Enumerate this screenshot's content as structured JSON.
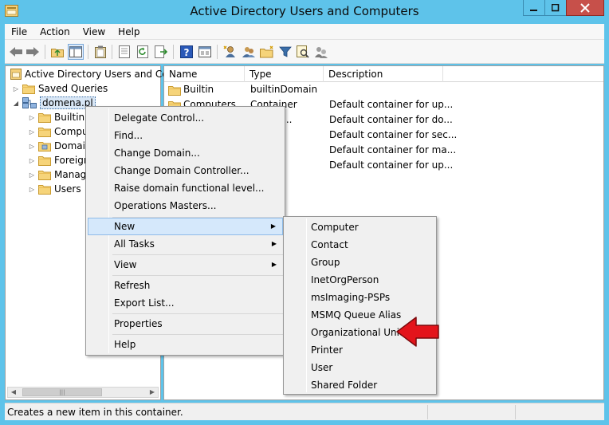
{
  "window": {
    "title": "Active Directory Users and Computers"
  },
  "menubar": [
    "File",
    "Action",
    "View",
    "Help"
  ],
  "tree": {
    "root": "Active Directory Users and Com",
    "saved_queries": "Saved Queries",
    "domain": "domena.pl",
    "children": [
      "Builtin",
      "Compu",
      "Domain",
      "Foreign",
      "Manag",
      "Users"
    ]
  },
  "list": {
    "columns": [
      "Name",
      "Type",
      "Description"
    ],
    "rows": [
      {
        "name": "Builtin",
        "type": "builtinDomain",
        "description": ""
      },
      {
        "name": "Computers",
        "type": "Container",
        "description": "Default container for up..."
      },
      {
        "name": "",
        "type": "ational...",
        "description": "Default container for do..."
      },
      {
        "name": "",
        "type": "r",
        "description": "Default container for sec..."
      },
      {
        "name": "",
        "type": "r",
        "description": "Default container for ma..."
      },
      {
        "name": "",
        "type": "r",
        "description": "Default container for up..."
      }
    ]
  },
  "context_menu": {
    "items": [
      "Delegate Control...",
      "Find...",
      "Change Domain...",
      "Change Domain Controller...",
      "Raise domain functional level...",
      "Operations Masters...",
      "New",
      "All Tasks",
      "View",
      "Refresh",
      "Export List...",
      "Properties",
      "Help"
    ],
    "highlighted": "New"
  },
  "submenu": {
    "items": [
      "Computer",
      "Contact",
      "Group",
      "InetOrgPerson",
      "msImaging-PSPs",
      "MSMQ Queue Alias",
      "Organizational Unit",
      "Printer",
      "User",
      "Shared Folder"
    ]
  },
  "statusbar": {
    "text": "Creates a new item in this container."
  },
  "icons": {
    "nav": [
      "back-arrow-icon",
      "forward-arrow-icon"
    ],
    "tools": [
      "up-folder-icon",
      "console-tree-icon",
      "clipboard-icon",
      "properties-icon",
      "refresh-icon",
      "export-list-icon",
      "help-icon",
      "mmc-view-icon",
      "new-user-icon",
      "new-group-icon",
      "new-ou-icon",
      "filter-icon",
      "find-icon",
      "add-to-group-icon"
    ]
  },
  "colors": {
    "title_bar": "#5ec3ea",
    "close_button": "#c7504a",
    "highlight": "#d5e8fb",
    "annotation_arrow": "#e3141b"
  }
}
